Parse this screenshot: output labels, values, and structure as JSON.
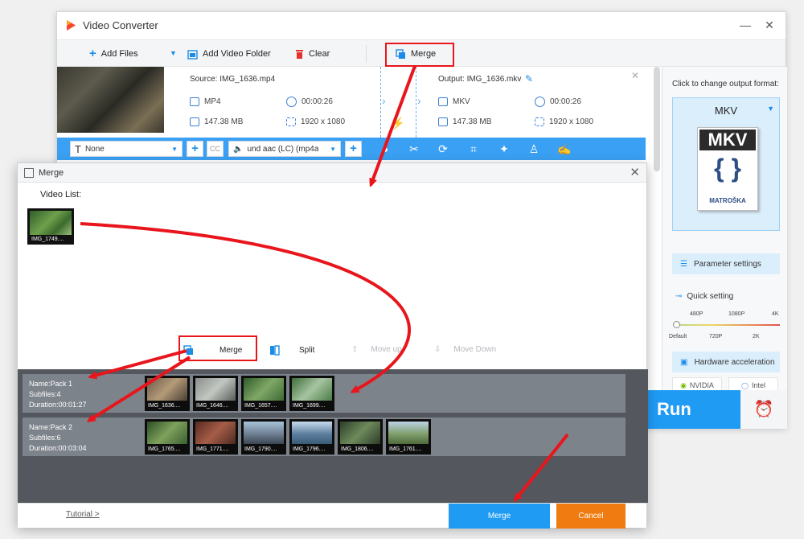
{
  "window": {
    "title": "Video Converter",
    "minimize": "—",
    "close": "✕"
  },
  "toolbar": {
    "add_files": "Add Files",
    "add_folder": "Add Video Folder",
    "clear": "Clear",
    "merge": "Merge"
  },
  "file": {
    "source": "Source: IMG_1636.mp4",
    "src_format": "MP4",
    "src_duration": "00:00:26",
    "src_size": "147.38 MB",
    "src_resolution": "1920 x 1080",
    "output": "Output: IMG_1636.mkv",
    "out_format": "MKV",
    "out_duration": "00:00:26",
    "out_size": "147.38 MB",
    "out_resolution": "1920 x 1080"
  },
  "editbar": {
    "subtitle": "None",
    "audio": "und aac (LC) (mp4a"
  },
  "right_panel": {
    "hint": "Click to change output format:",
    "format": "MKV",
    "logo_text": "MKV",
    "logo_sub": "MATROŠKA",
    "parameter_settings": "Parameter settings",
    "quick_setting": "Quick setting",
    "ticks_top": [
      "480P",
      "1080P",
      "4K"
    ],
    "ticks_bottom": [
      "Default",
      "720P",
      "2K"
    ],
    "hw_accel": "Hardware acceleration",
    "nvidia": "NVIDIA",
    "intel": "Intel",
    "run": "Run"
  },
  "merge_dialog": {
    "title": "Merge",
    "video_list_label": "Video List:",
    "video_list_item": "IMG_1749....",
    "actions": {
      "merge": "Merge",
      "split": "Split",
      "move_up": "Move up",
      "move_down": "Move Down"
    },
    "packs": [
      {
        "name": "Name:Pack 1",
        "subfiles": "Subfiles:4",
        "duration": "Duration:00:01:27",
        "thumbs": [
          "IMG_1636....",
          "IMG_1646....",
          "IMG_1657....",
          "IMG_1699...."
        ]
      },
      {
        "name": "Name:Pack 2",
        "subfiles": "Subfiles:6",
        "duration": "Duration:00:03:04",
        "thumbs": [
          "IMG_1765....",
          "IMG_1771....",
          "IMG_1790....",
          "IMG_1796....",
          "IMG_1806....",
          "IMG_1761...."
        ]
      }
    ],
    "tutorial": "Tutorial >",
    "merge_button": "Merge",
    "cancel_button": "Cancel"
  },
  "colors": {
    "accent": "#1f9bf4",
    "highlight": "#e8161c",
    "cancel": "#f07b11"
  }
}
